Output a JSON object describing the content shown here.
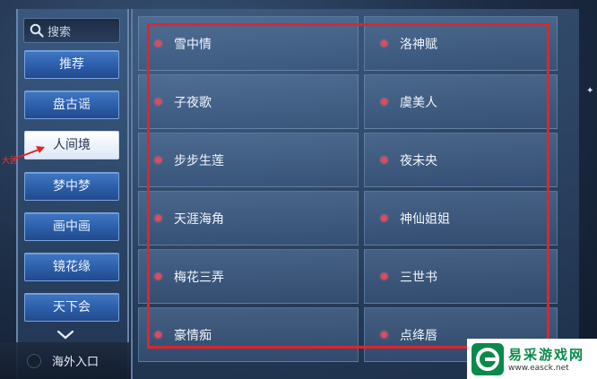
{
  "search": {
    "placeholder": "搜索"
  },
  "sidebar": {
    "items": [
      {
        "label": "推荐"
      },
      {
        "label": "盘古谣"
      },
      {
        "label": "人间境"
      },
      {
        "label": "梦中梦"
      },
      {
        "label": "画中画"
      },
      {
        "label": "镜花缘"
      },
      {
        "label": "天下会"
      }
    ],
    "active_index": 2
  },
  "overseas": {
    "label": "海外入口"
  },
  "annotation": {
    "label": "大区"
  },
  "servers": [
    {
      "name": "雪中情"
    },
    {
      "name": "洛神赋"
    },
    {
      "name": "子夜歌"
    },
    {
      "name": "虞美人"
    },
    {
      "name": "步步生莲"
    },
    {
      "name": "夜未央"
    },
    {
      "name": "天涯海角"
    },
    {
      "name": "神仙姐姐"
    },
    {
      "name": "梅花三弄"
    },
    {
      "name": "三世书"
    },
    {
      "name": "豪情痴"
    },
    {
      "name": "点绛唇"
    }
  ],
  "watermark": {
    "title": "易采游戏网",
    "url": "www.easck.net"
  },
  "colors": {
    "accent": "#2c5ea9",
    "highlight_box": "#e0242b",
    "bullet": "#e04a5c",
    "brand": "#0a8a4a"
  }
}
